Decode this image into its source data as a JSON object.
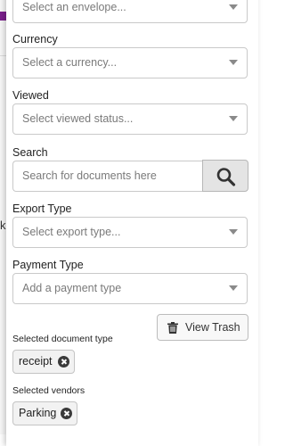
{
  "background": {
    "partial_letter": "k"
  },
  "filters": {
    "envelope": {
      "placeholder": "Select an envelope..."
    },
    "currency": {
      "label": "Currency",
      "placeholder": "Select a currency..."
    },
    "viewed": {
      "label": "Viewed",
      "placeholder": "Select viewed status..."
    },
    "search": {
      "label": "Search",
      "placeholder": "Search for documents here",
      "button_icon": "search-icon"
    },
    "export_type": {
      "label": "Export Type",
      "placeholder": "Select export type..."
    },
    "payment_type": {
      "label": "Payment Type",
      "placeholder": "Add a payment type"
    }
  },
  "view_trash": {
    "label": "View Trash",
    "icon": "trash-icon"
  },
  "selected_document_type": {
    "label": "Selected document type",
    "chips": [
      "receipt"
    ]
  },
  "selected_vendors": {
    "label": "Selected vendors",
    "chips": [
      "Parking"
    ]
  },
  "colors": {
    "accent_purple": "#7b1f8c",
    "border": "#c9c9c9",
    "search_button_bg": "#e4e4e4"
  }
}
